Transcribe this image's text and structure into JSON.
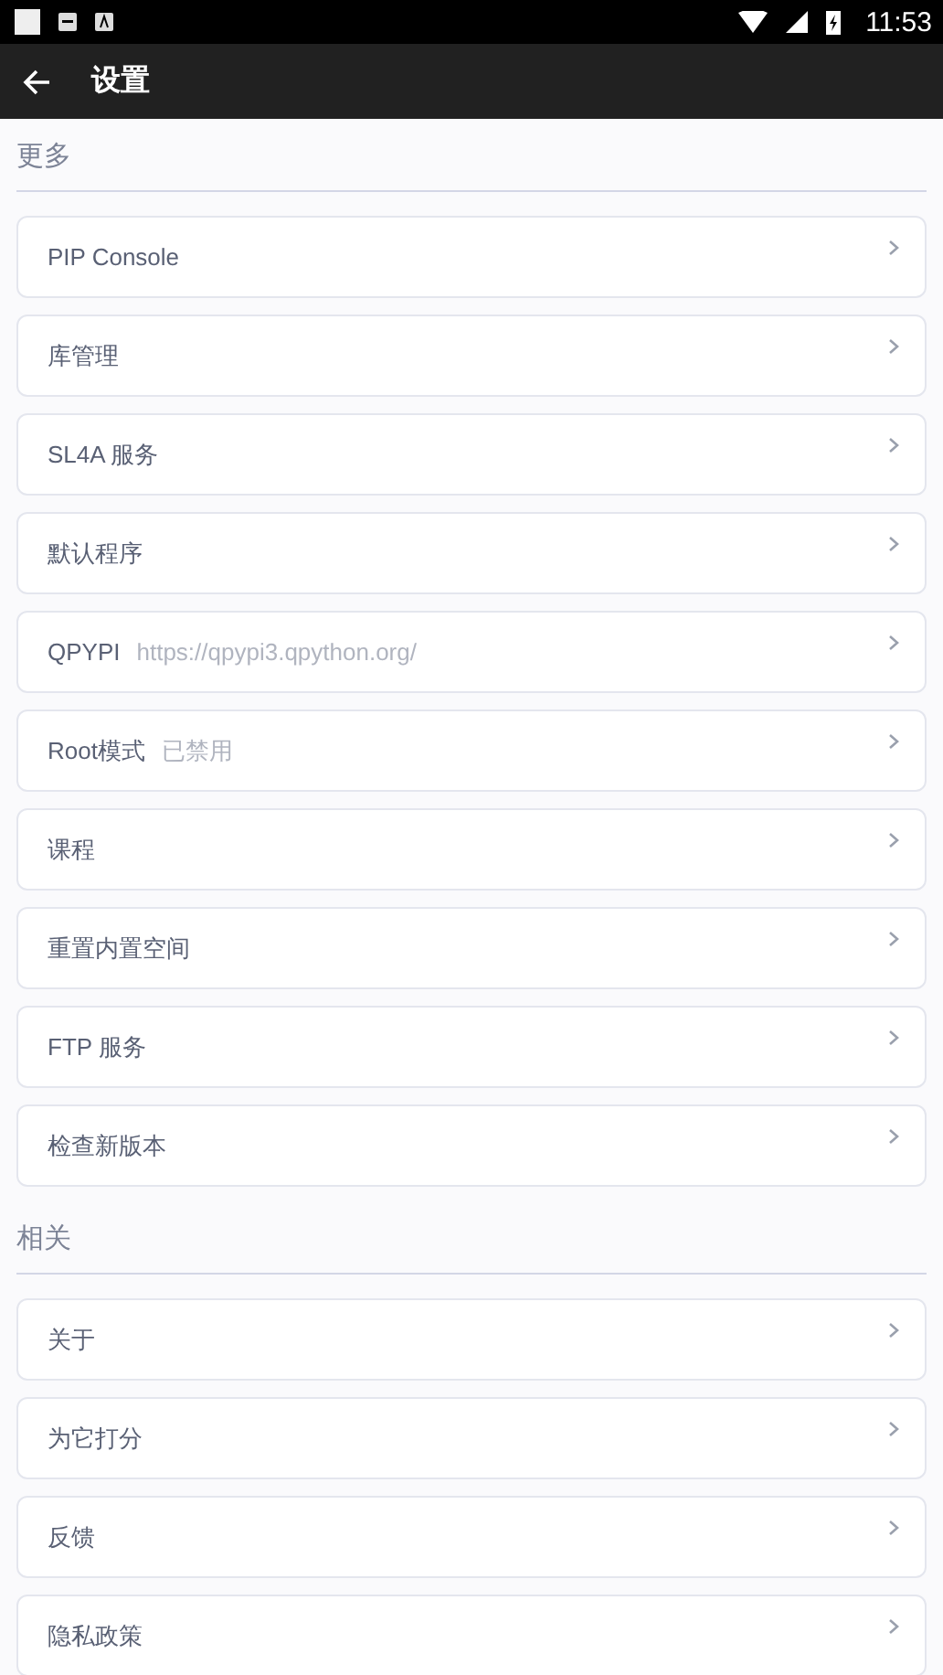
{
  "status_bar": {
    "time": "11:53"
  },
  "toolbar": {
    "title": "设置"
  },
  "sections": [
    {
      "title": "更多",
      "items": [
        {
          "label": "PIP Console"
        },
        {
          "label": "库管理"
        },
        {
          "label": "SL4A 服务"
        },
        {
          "label": "默认程序"
        },
        {
          "label": "QPYPI",
          "value": "https://qpypi3.qpython.org/"
        },
        {
          "label": "Root模式",
          "value": "已禁用"
        },
        {
          "label": "课程"
        },
        {
          "label": "重置内置空间"
        },
        {
          "label": "FTP 服务"
        },
        {
          "label": "检查新版本"
        }
      ]
    },
    {
      "title": "相关",
      "items": [
        {
          "label": "关于"
        },
        {
          "label": "为它打分"
        },
        {
          "label": "反馈"
        },
        {
          "label": "隐私政策"
        }
      ]
    }
  ]
}
